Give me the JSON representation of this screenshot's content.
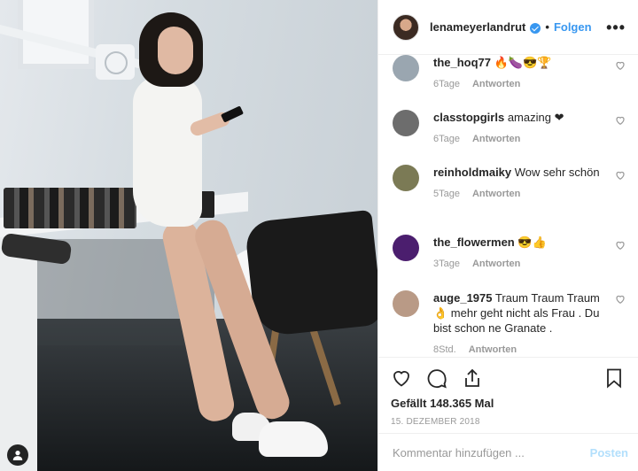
{
  "header": {
    "username": "lenameyerlandrut",
    "separator": "•",
    "follow_label": "Folgen",
    "more_label": "•••",
    "verified": true
  },
  "comments": [
    {
      "user": "the_hoq77",
      "text": "🔥🍆😎🏆",
      "age": "6Tage",
      "reply": "Antworten",
      "avatar_color": "#9aa6b0"
    },
    {
      "user": "classtopgirls",
      "text": "amazing ❤",
      "age": "6Tage",
      "reply": "Antworten",
      "avatar_color": "#6d6d6d"
    },
    {
      "user": "reinholdmaiky",
      "text": "Wow sehr schön",
      "age": "5Tage",
      "reply": "Antworten",
      "avatar_color": "#7b7a55"
    },
    {
      "user": "the_flowermen",
      "text": "😎👍",
      "age": "3Tage",
      "reply": "Antworten",
      "avatar_color": "#4b1e6e"
    },
    {
      "user": "auge_1975",
      "text": "Traum Traum Traum 👌 mehr geht nicht als Frau . Du bist schon ne Granate .",
      "age": "8Std.",
      "reply": "Antworten",
      "avatar_color": "#b99a86"
    }
  ],
  "actions": {
    "likes_text": "Gefällt 148.365 Mal",
    "date_text": "15. DEZEMBER 2018"
  },
  "add_comment": {
    "placeholder": "Kommentar hinzufügen ...",
    "post_label": "Posten"
  },
  "colors": {
    "accent": "#3897f0",
    "post_disabled": "#b2dffc",
    "meta": "#999999"
  }
}
